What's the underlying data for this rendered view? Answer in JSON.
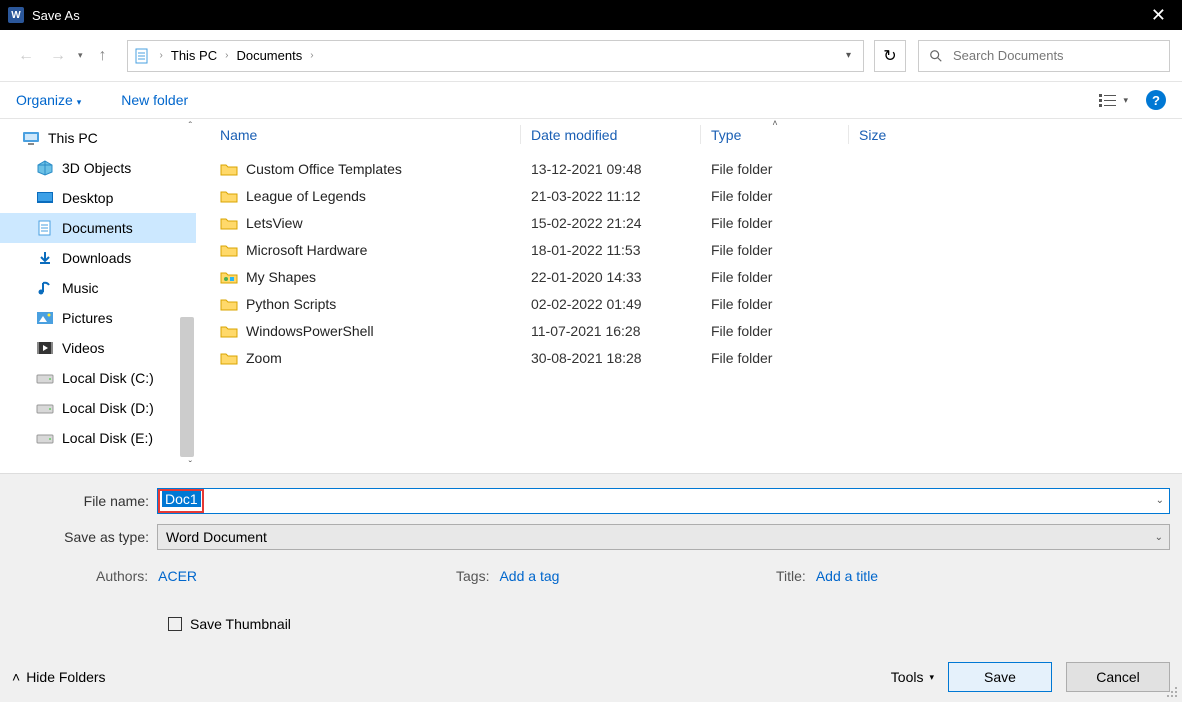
{
  "title": "Save As",
  "breadcrumb": {
    "root": "This PC",
    "current": "Documents"
  },
  "search": {
    "placeholder": "Search Documents"
  },
  "toolbar": {
    "organize": "Organize",
    "newfolder": "New folder"
  },
  "sidebar": {
    "top": "This PC",
    "items": [
      {
        "label": "3D Objects",
        "icon": "3d"
      },
      {
        "label": "Desktop",
        "icon": "desktop"
      },
      {
        "label": "Documents",
        "icon": "documents",
        "selected": true
      },
      {
        "label": "Downloads",
        "icon": "downloads"
      },
      {
        "label": "Music",
        "icon": "music"
      },
      {
        "label": "Pictures",
        "icon": "pictures"
      },
      {
        "label": "Videos",
        "icon": "videos"
      },
      {
        "label": "Local Disk (C:)",
        "icon": "disk"
      },
      {
        "label": "Local Disk (D:)",
        "icon": "disk"
      },
      {
        "label": "Local Disk (E:)",
        "icon": "disk"
      }
    ]
  },
  "columns": {
    "name": "Name",
    "date": "Date modified",
    "type": "Type",
    "size": "Size"
  },
  "files": [
    {
      "name": "Custom Office Templates",
      "date": "13-12-2021 09:48",
      "type": "File folder",
      "icon": "folder"
    },
    {
      "name": "League of Legends",
      "date": "21-03-2022 11:12",
      "type": "File folder",
      "icon": "folder"
    },
    {
      "name": "LetsView",
      "date": "15-02-2022 21:24",
      "type": "File folder",
      "icon": "folder"
    },
    {
      "name": "Microsoft Hardware",
      "date": "18-01-2022 11:53",
      "type": "File folder",
      "icon": "folder"
    },
    {
      "name": "My Shapes",
      "date": "22-01-2020 14:33",
      "type": "File folder",
      "icon": "shapes"
    },
    {
      "name": "Python Scripts",
      "date": "02-02-2022 01:49",
      "type": "File folder",
      "icon": "folder"
    },
    {
      "name": "WindowsPowerShell",
      "date": "11-07-2021 16:28",
      "type": "File folder",
      "icon": "folder"
    },
    {
      "name": "Zoom",
      "date": "30-08-2021 18:28",
      "type": "File folder",
      "icon": "folder"
    }
  ],
  "form": {
    "filename_label": "File name:",
    "filename_value": "Doc1",
    "savetype_label": "Save as type:",
    "savetype_value": "Word Document",
    "authors_label": "Authors:",
    "authors_value": "ACER",
    "tags_label": "Tags:",
    "tags_value": "Add a tag",
    "title_label": "Title:",
    "title_value": "Add a title",
    "thumbnail_label": "Save Thumbnail"
  },
  "footer": {
    "hide_folders": "Hide Folders",
    "tools": "Tools",
    "save": "Save",
    "cancel": "Cancel"
  }
}
